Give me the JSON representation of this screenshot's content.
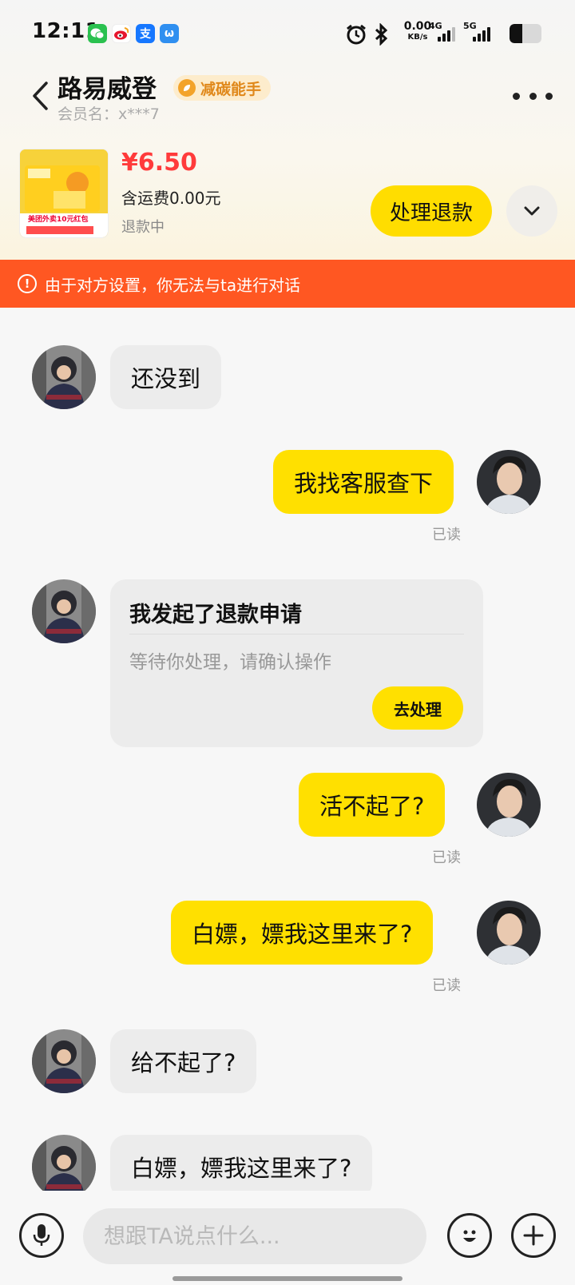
{
  "status_bar": {
    "time": "12:11",
    "apps": [
      {
        "icon": "wechat-icon",
        "glyph": "●",
        "color": "#2ac14f"
      },
      {
        "icon": "weibo-icon",
        "glyph": "◎",
        "color": "#f4a21b"
      },
      {
        "icon": "alipay-icon",
        "glyph": "支",
        "color": "#1677ff"
      },
      {
        "icon": "mini-app-icon",
        "glyph": "ω",
        "color": "#2f8ff0"
      }
    ],
    "net_speed_value": "0.00",
    "net_speed_unit": "KB/s",
    "network_1": "4G",
    "network_2": "5G",
    "battery_level": 0.4
  },
  "header": {
    "name": "路易威登",
    "badge": "减碳能手",
    "member_label": "会员名：",
    "member_id": "x***7"
  },
  "order": {
    "thumbnail_label": "美团外卖10元红包",
    "price": "¥6.50",
    "shipping": "含运费0.00元",
    "status": "退款中",
    "action_label": "处理退款"
  },
  "warning": {
    "icon": "!",
    "text": "由于对方设置，你无法与ta进行对话"
  },
  "messages": {
    "m1": "还没到",
    "m2": "我找客服查下",
    "m2_read": "已读",
    "refund_title": "我发起了退款申请",
    "refund_desc": "等待你处理，请确认操作",
    "refund_action": "去处理",
    "m4": "活不起了?",
    "m4_read": "已读",
    "m5": "白嫖，嫖我这里来了?",
    "m5_read": "已读",
    "m6": "给不起了?",
    "m7": "白嫖，嫖我这里来了?"
  },
  "input": {
    "placeholder": "想跟TA说点什么..."
  },
  "colors": {
    "accent": "#ffe000",
    "warning": "#ff5722",
    "price": "#ff3b3b"
  }
}
